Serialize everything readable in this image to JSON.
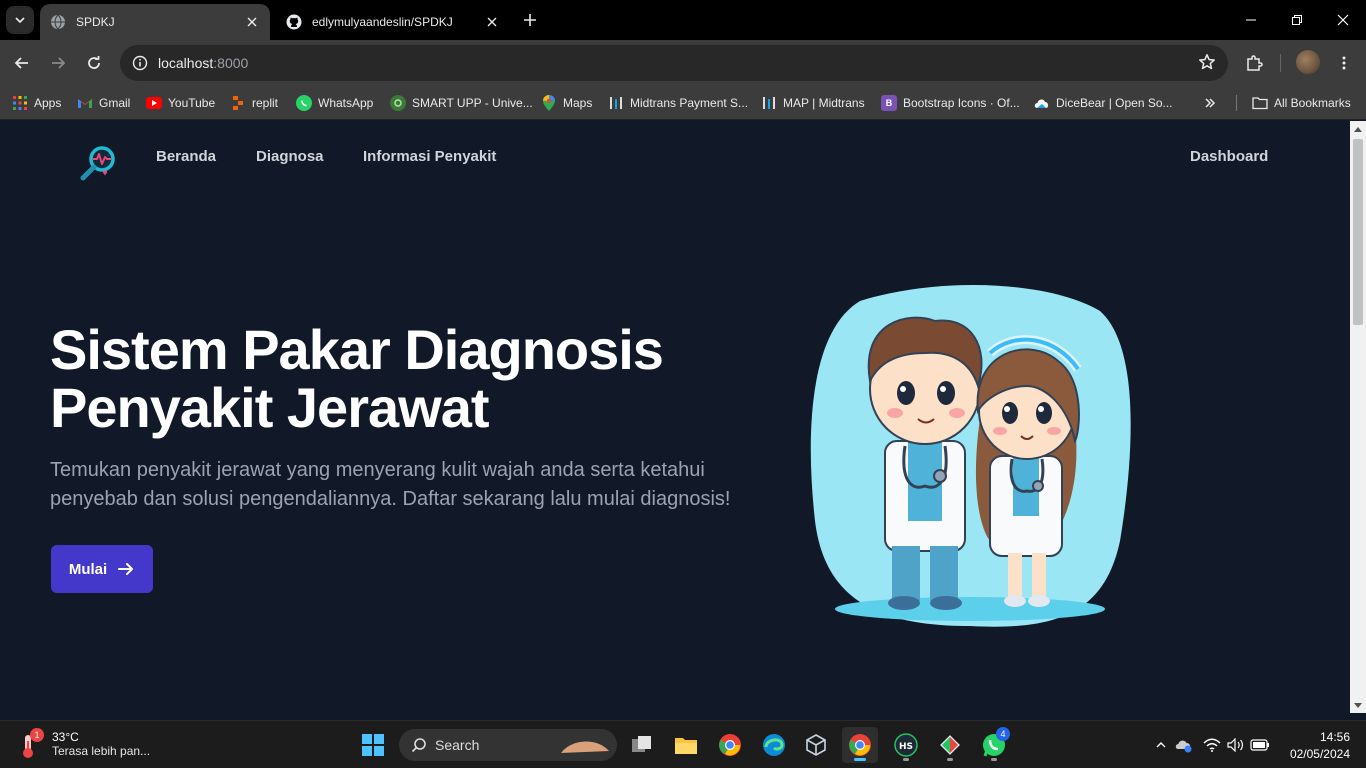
{
  "browser": {
    "tabs": [
      {
        "title": "SPDKJ",
        "active": true
      },
      {
        "title": "edlymulyaandeslin/SPDKJ",
        "active": false
      }
    ],
    "url_host": "localhost",
    "url_port": ":8000",
    "bookmarks": [
      {
        "label": "Apps",
        "icon": "apps-grid-icon"
      },
      {
        "label": "Gmail",
        "icon": "gmail-icon"
      },
      {
        "label": "YouTube",
        "icon": "youtube-icon"
      },
      {
        "label": "replit",
        "icon": "replit-icon"
      },
      {
        "label": "WhatsApp",
        "icon": "whatsapp-icon"
      },
      {
        "label": "SMART UPP - Unive...",
        "icon": "smart-upp-icon"
      },
      {
        "label": "Maps",
        "icon": "maps-icon"
      },
      {
        "label": "Midtrans Payment S...",
        "icon": "midtrans-icon"
      },
      {
        "label": "MAP | Midtrans",
        "icon": "midtrans-icon"
      },
      {
        "label": "Bootstrap Icons · Of...",
        "icon": "bootstrap-icon"
      },
      {
        "label": "DiceBear | Open So...",
        "icon": "dicebear-icon"
      }
    ],
    "all_bookmarks": "All Bookmarks"
  },
  "page": {
    "nav": {
      "links": [
        "Beranda",
        "Diagnosa",
        "Informasi Penyakit"
      ],
      "dashboard": "Dashboard"
    },
    "hero": {
      "title_line1": "Sistem Pakar Diagnosis",
      "title_line2": "Penyakit Jerawat",
      "subtitle": "Temukan penyakit jerawat yang menyerang kulit wajah anda serta ketahui penyebab dan solusi pengendaliannya. Daftar sekarang lalu mulai diagnosis!",
      "cta_label": "Mulai"
    },
    "colors": {
      "background": "#111827",
      "accent": "#4338ca"
    }
  },
  "taskbar": {
    "weather_temp": "33°C",
    "weather_desc": "Terasa lebih pan...",
    "weather_badge": "1",
    "search_label": "Search",
    "whatsapp_badge": "4",
    "time": "14:56",
    "date": "02/05/2024"
  }
}
